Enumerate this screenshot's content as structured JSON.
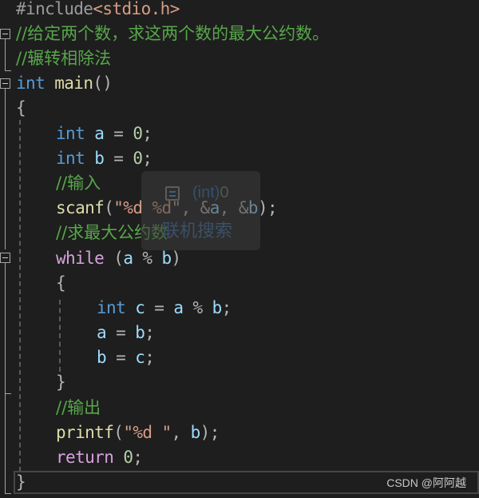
{
  "editor": {
    "lines": [
      {
        "id": "l1",
        "parts": [
          {
            "t": "#include",
            "c": "pre"
          },
          {
            "t": "<stdio.h>",
            "c": "inc"
          }
        ]
      },
      {
        "id": "l2",
        "parts": [
          {
            "t": "//给定两个数，求这两个数的最大公约数。",
            "c": "cm"
          }
        ]
      },
      {
        "id": "l3",
        "parts": [
          {
            "t": "//辗转相除法",
            "c": "cm"
          }
        ]
      },
      {
        "id": "l4",
        "parts": [
          {
            "t": "int",
            "c": "kw"
          },
          {
            "t": " ",
            "c": ""
          },
          {
            "t": "main",
            "c": "fn"
          },
          {
            "t": "()",
            "c": "punc"
          }
        ]
      },
      {
        "id": "l5",
        "parts": [
          {
            "t": "{",
            "c": "brace"
          }
        ]
      },
      {
        "id": "l6",
        "parts": [
          {
            "t": "int",
            "c": "kw"
          },
          {
            "t": " ",
            "c": ""
          },
          {
            "t": "a",
            "c": "var"
          },
          {
            "t": " = ",
            "c": "punc"
          },
          {
            "t": "0",
            "c": "num"
          },
          {
            "t": ";",
            "c": "punc"
          }
        ]
      },
      {
        "id": "l7",
        "parts": [
          {
            "t": "int",
            "c": "kw"
          },
          {
            "t": " ",
            "c": ""
          },
          {
            "t": "b",
            "c": "var"
          },
          {
            "t": " = ",
            "c": "punc"
          },
          {
            "t": "0",
            "c": "num"
          },
          {
            "t": ";",
            "c": "punc"
          }
        ]
      },
      {
        "id": "l8",
        "parts": [
          {
            "t": "//输入",
            "c": "cm"
          }
        ]
      },
      {
        "id": "l9",
        "parts": [
          {
            "t": "scanf",
            "c": "fn"
          },
          {
            "t": "(",
            "c": "punc"
          },
          {
            "t": "\"%d %d\"",
            "c": "str"
          },
          {
            "t": ", ",
            "c": "punc"
          },
          {
            "t": "&",
            "c": "punc"
          },
          {
            "t": "a",
            "c": "var"
          },
          {
            "t": ", ",
            "c": "punc"
          },
          {
            "t": "&",
            "c": "punc"
          },
          {
            "t": "b",
            "c": "var"
          },
          {
            "t": ");",
            "c": "punc"
          }
        ]
      },
      {
        "id": "l10",
        "parts": [
          {
            "t": "//求最大公约数",
            "c": "cm"
          }
        ]
      },
      {
        "id": "l11",
        "parts": [
          {
            "t": "while",
            "c": "kw-ctrl"
          },
          {
            "t": " (",
            "c": "punc"
          },
          {
            "t": "a",
            "c": "var"
          },
          {
            "t": " % ",
            "c": "punc"
          },
          {
            "t": "b",
            "c": "var"
          },
          {
            "t": ")",
            "c": "punc"
          }
        ]
      },
      {
        "id": "l12",
        "parts": [
          {
            "t": "{",
            "c": "brace"
          }
        ]
      },
      {
        "id": "l13",
        "parts": [
          {
            "t": "int",
            "c": "kw"
          },
          {
            "t": " ",
            "c": ""
          },
          {
            "t": "c",
            "c": "var"
          },
          {
            "t": " = ",
            "c": "punc"
          },
          {
            "t": "a",
            "c": "var"
          },
          {
            "t": " % ",
            "c": "punc"
          },
          {
            "t": "b",
            "c": "var"
          },
          {
            "t": ";",
            "c": "punc"
          }
        ]
      },
      {
        "id": "l14",
        "parts": [
          {
            "t": "a",
            "c": "var"
          },
          {
            "t": " = ",
            "c": "punc"
          },
          {
            "t": "b",
            "c": "var"
          },
          {
            "t": ";",
            "c": "punc"
          }
        ]
      },
      {
        "id": "l15",
        "parts": [
          {
            "t": "b",
            "c": "var"
          },
          {
            "t": " = ",
            "c": "punc"
          },
          {
            "t": "c",
            "c": "var"
          },
          {
            "t": ";",
            "c": "punc"
          }
        ]
      },
      {
        "id": "l16",
        "parts": [
          {
            "t": "}",
            "c": "brace"
          }
        ]
      },
      {
        "id": "l17",
        "parts": [
          {
            "t": "//输出",
            "c": "cm"
          }
        ]
      },
      {
        "id": "l18",
        "parts": [
          {
            "t": "printf",
            "c": "fn"
          },
          {
            "t": "(",
            "c": "punc"
          },
          {
            "t": "\"%d \"",
            "c": "str"
          },
          {
            "t": ", ",
            "c": "punc"
          },
          {
            "t": "b",
            "c": "var"
          },
          {
            "t": ");",
            "c": "punc"
          }
        ]
      },
      {
        "id": "l19",
        "parts": [
          {
            "t": "return",
            "c": "kw-ctrl"
          },
          {
            "t": " ",
            "c": ""
          },
          {
            "t": "0",
            "c": "num"
          },
          {
            "t": ";",
            "c": "punc"
          }
        ]
      },
      {
        "id": "l20",
        "parts": [
          {
            "t": "}",
            "c": "brace"
          }
        ]
      }
    ]
  },
  "tooltip": {
    "type_prefix": "(int)",
    "type_value": "0",
    "action": "联机搜索",
    "icon": "quick-info-icon"
  },
  "watermark": "CSDN @阿阿越",
  "colors": {
    "background": "#1e1e1e",
    "keyword": "#569cd6",
    "control_keyword": "#d8a0df",
    "function": "#dcdcaa",
    "comment": "#57a64a",
    "variable": "#9cdcfe",
    "number": "#b5cea8",
    "string": "#d69d85"
  }
}
